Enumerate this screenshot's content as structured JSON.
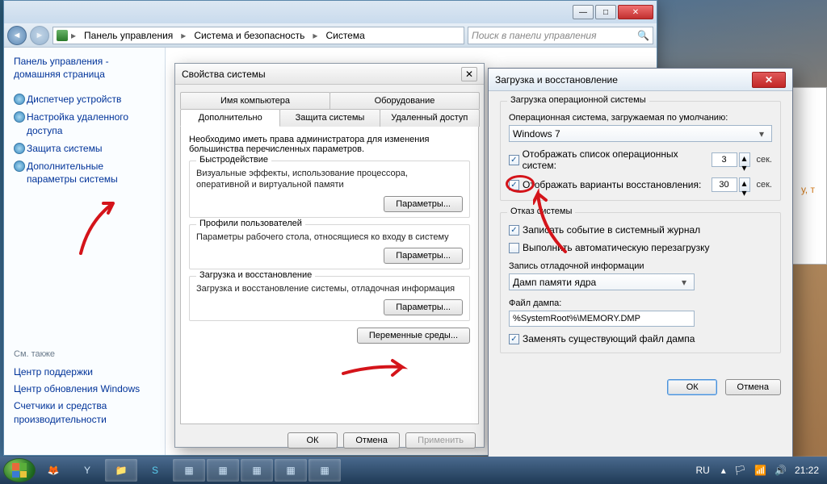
{
  "explorer": {
    "breadcrumb": [
      "Панель управления",
      "Система и безопасность",
      "Система"
    ],
    "search_placeholder": "Поиск в панели управления",
    "home": "Панель управления - домашняя страница",
    "links": [
      "Диспетчер устройств",
      "Настройка удаленного доступа",
      "Защита системы",
      "Дополнительные параметры системы"
    ],
    "see_also_label": "См. также",
    "see_also": [
      "Центр поддержки",
      "Центр обновления Windows",
      "Счетчики и средства производительности"
    ]
  },
  "sysprops": {
    "title": "Свойства системы",
    "tabs_top": [
      "Имя компьютера",
      "Оборудование"
    ],
    "tabs_bottom": [
      "Дополнительно",
      "Защита системы",
      "Удаленный доступ"
    ],
    "note": "Необходимо иметь права администратора для изменения большинства перечисленных параметров.",
    "perf_title": "Быстродействие",
    "perf_desc": "Визуальные эффекты, использование процессора, оперативной и виртуальной памяти",
    "profiles_title": "Профили пользователей",
    "profiles_desc": "Параметры рабочего стола, относящиеся ко входу в систему",
    "boot_title": "Загрузка и восстановление",
    "boot_desc": "Загрузка и восстановление системы, отладочная информация",
    "params_btn": "Параметры...",
    "env_btn": "Переменные среды...",
    "ok": "ОК",
    "cancel": "Отмена",
    "apply": "Применить"
  },
  "boot": {
    "title": "Загрузка и восстановление",
    "startup_title": "Загрузка операционной системы",
    "default_os_label": "Операционная система, загружаемая по умолчанию:",
    "default_os": "Windows 7",
    "show_os_list": "Отображать список операционных систем:",
    "show_os_time": "3",
    "show_recovery": "Отображать варианты восстановления:",
    "show_recovery_time": "30",
    "sec": "сек.",
    "failure_title": "Отказ системы",
    "log_event": "Записать событие в системный журнал",
    "auto_restart": "Выполнить автоматическую перезагрузку",
    "debug_label": "Запись отладочной информации",
    "debug_type": "Дамп памяти ядра",
    "dump_file_label": "Файл дампа:",
    "dump_file": "%SystemRoot%\\MEMORY.DMP",
    "overwrite": "Заменять существующий файл дампа",
    "ok": "ОК",
    "cancel": "Отмена"
  },
  "taskbar": {
    "lang": "RU",
    "time": "21:22"
  },
  "bg_text": "у, т"
}
